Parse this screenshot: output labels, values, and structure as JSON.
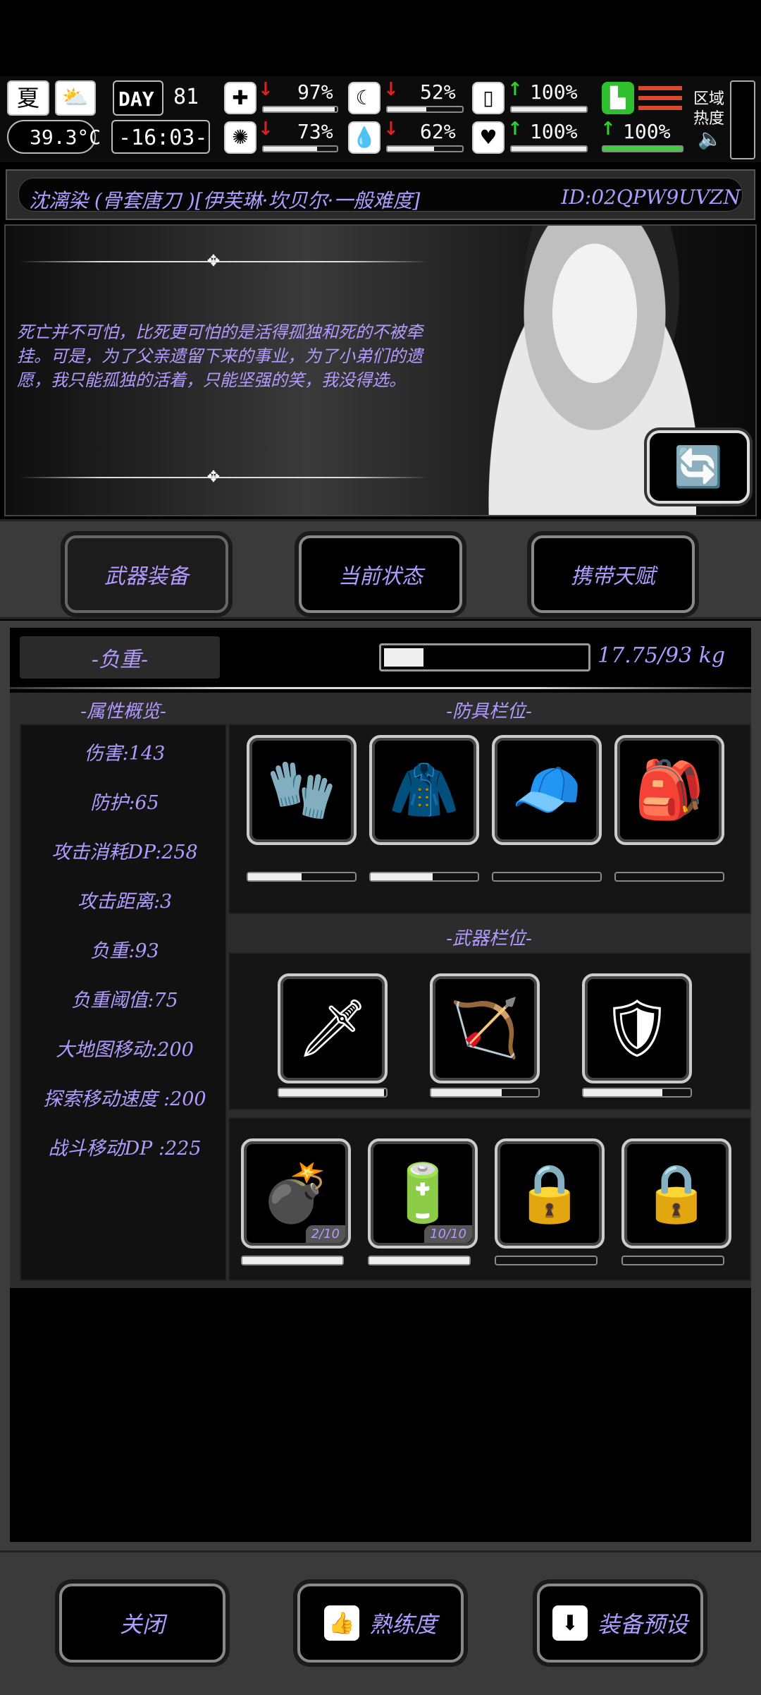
{
  "status": {
    "season": "夏",
    "temperature": "39.3°C",
    "day_label": "DAY",
    "day": "81",
    "time": "-16:03-",
    "stats": [
      {
        "name": "health",
        "icon": "medkit-icon",
        "value": "97%",
        "trend": "down",
        "level": 0.97
      },
      {
        "name": "hunger",
        "icon": "stomach-icon",
        "value": "52%",
        "trend": "down",
        "level": 0.52
      },
      {
        "name": "energy",
        "icon": "battery-icon",
        "value": "100%",
        "trend": "up",
        "level": 1.0
      },
      {
        "name": "sanity",
        "icon": "brain-icon",
        "value": "73%",
        "trend": "down",
        "level": 0.73
      },
      {
        "name": "thirst",
        "icon": "droplet-icon",
        "value": "62%",
        "trend": "down",
        "level": 0.62
      },
      {
        "name": "mood",
        "icon": "heart-icon",
        "value": "100%",
        "trend": "up",
        "level": 1.0
      }
    ],
    "stamina": {
      "value": "100%",
      "trend": "up",
      "level": 1.0
    },
    "region_label_1": "区域",
    "region_label_2": "热度"
  },
  "character": {
    "name_line": "沈漓染 (骨套唐刀 )[伊芙琳·坎贝尔·一般难度]",
    "id": "ID:02QPW9UVZN",
    "quote": "死亡并不可怕，比死更可怕的是活得孤独和死的不被牵挂。可是，为了父亲遗留下来的事业，为了小弟们的遗愿，我只能孤独的活着，只能坚强的笑，我没得选。"
  },
  "tabs": [
    {
      "label": "武器装备",
      "active": true
    },
    {
      "label": "当前状态",
      "active": false
    },
    {
      "label": "携带天赋",
      "active": false
    }
  ],
  "weight": {
    "label": "-负重-",
    "text": "17.75/93 kg",
    "level": 0.19
  },
  "attributes": {
    "title": "-属性概览-",
    "items": [
      "伤害:143",
      "防护:65",
      "攻击消耗DP:258",
      "攻击距离:3",
      "负重:93",
      "负重阈值:75",
      "大地图移动:200",
      "探索移动速度 :200",
      "战斗移动DP :225"
    ]
  },
  "armor": {
    "title": "-防具栏位-",
    "slots": [
      {
        "name": "gloves-icon",
        "glyph": "🧤",
        "durability": 0.5,
        "empty": false
      },
      {
        "name": "cloak-icon",
        "glyph": "🧥",
        "durability": 0.58,
        "empty": false
      },
      {
        "name": "cap-icon",
        "glyph": "🧢",
        "durability": 0.0,
        "empty": true
      },
      {
        "name": "backpack-icon",
        "glyph": "🎒",
        "durability": 0.0,
        "empty": false
      }
    ]
  },
  "weapons": {
    "title": "-武器栏位-",
    "slots": [
      {
        "name": "sword-icon",
        "glyph": "🗡",
        "durability": 0.98
      },
      {
        "name": "bow-icon",
        "glyph": "🏹",
        "durability": 0.66
      },
      {
        "name": "shield-icon",
        "glyph": "🛡",
        "durability": 0.74
      }
    ]
  },
  "consumables": {
    "slots": [
      {
        "name": "grenade-icon",
        "glyph": "💣",
        "count": "2/10",
        "durability": 1.0,
        "locked": false
      },
      {
        "name": "battery-item-icon",
        "glyph": "🔋",
        "count": "10/10",
        "durability": 1.0,
        "locked": false
      },
      {
        "name": "locked-slot-icon",
        "glyph": "🔒",
        "count": "",
        "durability": 0.0,
        "locked": true
      },
      {
        "name": "locked-slot-icon",
        "glyph": "🔒",
        "count": "",
        "durability": 0.0,
        "locked": true
      }
    ]
  },
  "footer": {
    "close_label": "关闭",
    "proficiency_label": "熟练度",
    "preset_label": "装备预设"
  }
}
